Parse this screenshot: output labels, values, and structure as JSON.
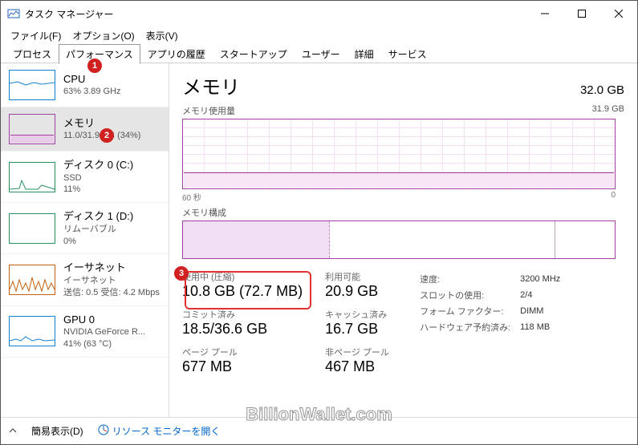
{
  "window": {
    "title": "タスク マネージャー"
  },
  "menu": {
    "file": "ファイル(F)",
    "options": "オプション(O)",
    "view": "表示(V)"
  },
  "tabs": {
    "processes": "プロセス",
    "performance": "パフォーマンス",
    "history": "アプリの履歴",
    "startup": "スタートアップ",
    "users": "ユーザー",
    "details": "詳細",
    "services": "サービス"
  },
  "sidebar": {
    "cpu": {
      "name": "CPU",
      "sub": "63%  3.89 GHz"
    },
    "memory": {
      "name": "メモリ",
      "sub": "11.0/31.9 GB (34%)"
    },
    "disk0": {
      "name": "ディスク 0 (C:)",
      "sub1": "SSD",
      "sub2": "11%"
    },
    "disk1": {
      "name": "ディスク 1 (D:)",
      "sub1": "リムーバブル",
      "sub2": "0%"
    },
    "eth": {
      "name": "イーサネット",
      "sub1": "イーサネット",
      "sub2": "送信: 0.5 受信: 4.2 Mbps"
    },
    "gpu": {
      "name": "GPU 0",
      "sub1": "NVIDIA GeForce R...",
      "sub2": "41% (63 °C)"
    }
  },
  "content": {
    "title": "メモリ",
    "total": "32.0 GB",
    "usage_label": "メモリ使用量",
    "usage_right": "31.9 GB",
    "axis_left": "60 秒",
    "axis_right": "0",
    "comp_label": "メモリ構成"
  },
  "stats": {
    "inuse_label": "使用中 (圧縮)",
    "inuse_val": "10.8 GB (72.7 MB)",
    "avail_label": "利用可能",
    "avail_val": "20.9 GB",
    "commit_label": "コミット済み",
    "commit_val": "18.5/36.6 GB",
    "cached_label": "キャッシュ済み",
    "cached_val": "16.7 GB",
    "paged_label": "ページ プール",
    "paged_val": "677 MB",
    "nonpaged_label": "非ページ プール",
    "nonpaged_val": "467 MB"
  },
  "spec": {
    "speed_l": "速度:",
    "speed_v": "3200 MHz",
    "slots_l": "スロットの使用:",
    "slots_v": "2/4",
    "form_l": "フォーム ファクター:",
    "form_v": "DIMM",
    "hw_l": "ハードウェア予約済み:",
    "hw_v": "118 MB"
  },
  "footer": {
    "fewer": "簡易表示(D)",
    "resmon": "リソース モニターを開く"
  },
  "badges": {
    "b1": "1",
    "b2": "2",
    "b3": "3"
  },
  "watermark": "BillionWallet.com"
}
